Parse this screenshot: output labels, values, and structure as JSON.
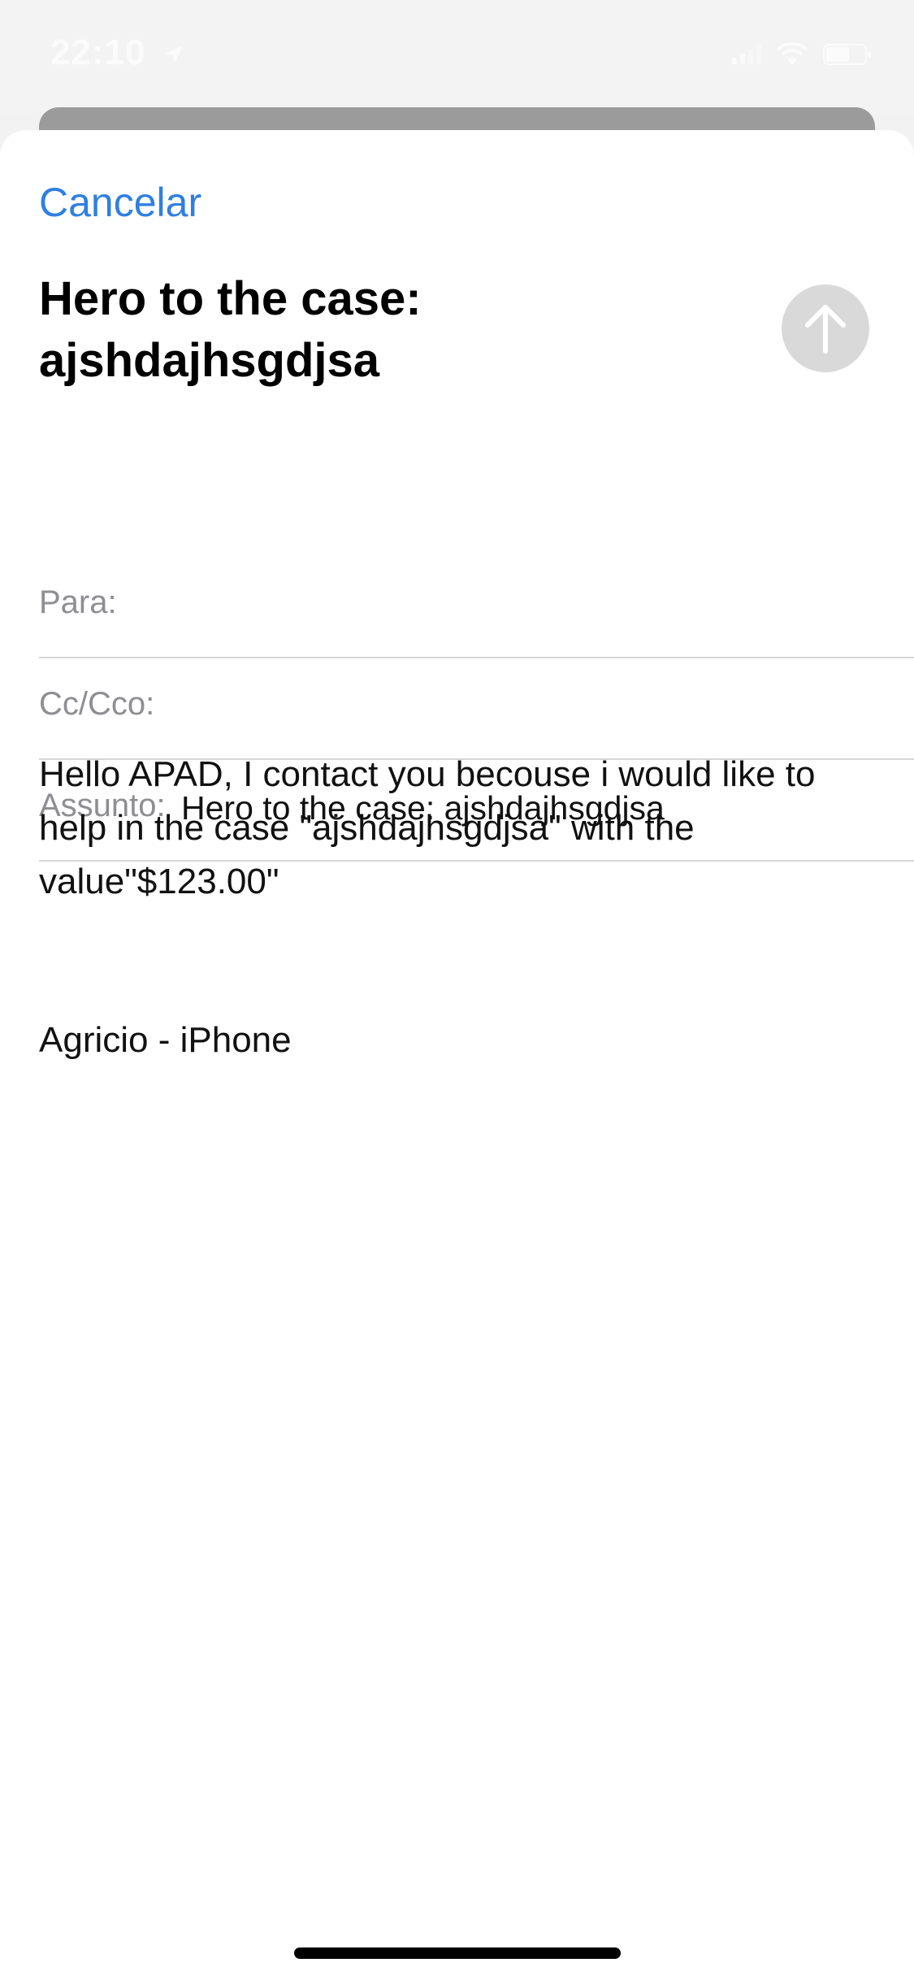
{
  "status_bar": {
    "time": "22:10",
    "location_icon": "location-arrow-icon",
    "signal_icon": "cellular-signal-icon",
    "wifi_icon": "wifi-icon",
    "battery_icon": "battery-icon"
  },
  "compose": {
    "cancel_label": "Cancelar",
    "title_line1": "Hero to the case:",
    "title_line2": "ajshdajhsgdjsa",
    "send_icon": "arrow-up-icon",
    "to_label": "Para:",
    "to_value": "",
    "cc_label": "Cc/Cco:",
    "cc_value": "",
    "subject_label": "Assunto:",
    "subject_value": "Hero to the case: ajshdajhsgdjsa",
    "body_line1": "Hello APAD, I contact you becouse i would like to",
    "body_line2": "help in the case \"ajshdajhsgdjsa\" with the",
    "body_line3": "value\"$123.00\"",
    "signature": "Agricio - iPhone"
  },
  "colors": {
    "accent": "#2f7fe0",
    "send_disabled": "#d9d9d9",
    "label_gray": "#8e8e93",
    "separator": "#d7d7d9"
  }
}
